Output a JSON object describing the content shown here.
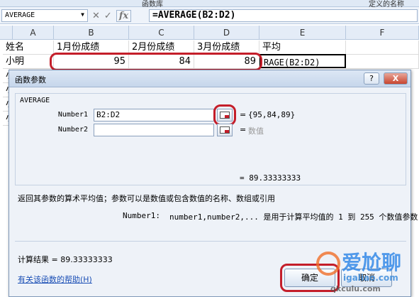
{
  "ribbon": {
    "left_tab": "函数库",
    "right_tab": "定义的名称"
  },
  "formula_bar": {
    "name_box": "AVERAGE",
    "cancel_glyph": "✕",
    "enter_glyph": "✓",
    "fx_label": "fx",
    "formula": "=AVERAGE(B2:D2)"
  },
  "grid": {
    "columns": [
      "A",
      "B",
      "C",
      "D",
      "E",
      "F"
    ],
    "row1": [
      "姓名",
      "1月份成绩",
      "2月份成绩",
      "3月份成绩",
      "平均"
    ],
    "row2": {
      "name": "小明",
      "b": "95",
      "c": "84",
      "d": "89",
      "e": "RAGE(B2:D2)"
    },
    "partial_rows": [
      "小",
      "小",
      "小",
      "小"
    ]
  },
  "dialog": {
    "title": "函数参数",
    "help_glyph": "?",
    "close_glyph": "X",
    "function_name": "AVERAGE",
    "args": [
      {
        "label": "Number1",
        "value": "B2:D2",
        "result": "{95,84,89}"
      },
      {
        "label": "Number2",
        "value": "",
        "result": "数值"
      }
    ],
    "equals": "=",
    "formula_result_line": "= 89.33333333",
    "description": "返回其参数的算术平均值；参数可以是数值或包含数值的名称、数组或引用",
    "arg_help_label": "Number1:",
    "arg_help_text": "number1,number2,... 是用于计算平均值的 1 到 255 个数值参数",
    "calc_result": "计算结果 = 89.33333333",
    "help_link": "有关该函数的帮助(H)",
    "ok": "确定",
    "cancel": "取消"
  },
  "watermark": {
    "main": "爱尬聊",
    "domain": "igaliao.com",
    "domain2": "qkculu.com"
  }
}
